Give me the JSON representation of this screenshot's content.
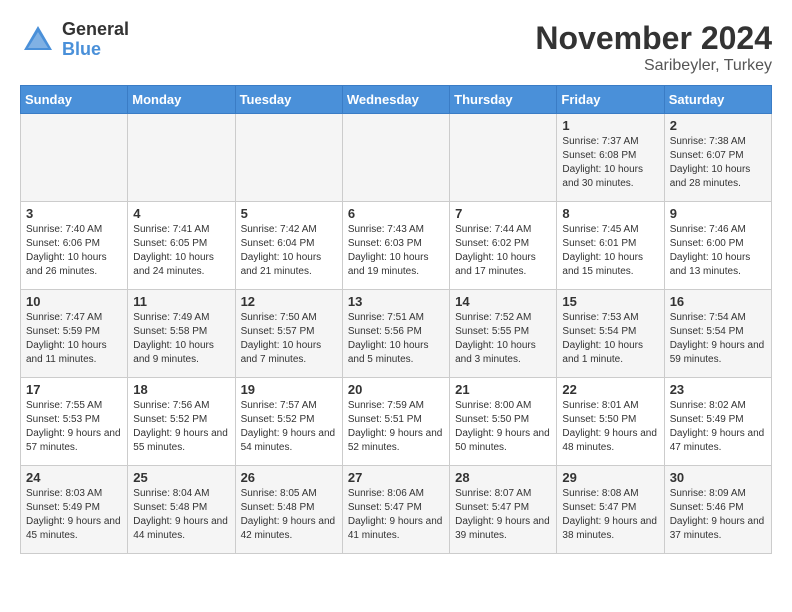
{
  "logo": {
    "general": "General",
    "blue": "Blue"
  },
  "title": "November 2024",
  "location": "Saribeyler, Turkey",
  "days_of_week": [
    "Sunday",
    "Monday",
    "Tuesday",
    "Wednesday",
    "Thursday",
    "Friday",
    "Saturday"
  ],
  "weeks": [
    [
      {
        "day": "",
        "info": ""
      },
      {
        "day": "",
        "info": ""
      },
      {
        "day": "",
        "info": ""
      },
      {
        "day": "",
        "info": ""
      },
      {
        "day": "",
        "info": ""
      },
      {
        "day": "1",
        "info": "Sunrise: 7:37 AM\nSunset: 6:08 PM\nDaylight: 10 hours and 30 minutes."
      },
      {
        "day": "2",
        "info": "Sunrise: 7:38 AM\nSunset: 6:07 PM\nDaylight: 10 hours and 28 minutes."
      }
    ],
    [
      {
        "day": "3",
        "info": "Sunrise: 7:40 AM\nSunset: 6:06 PM\nDaylight: 10 hours and 26 minutes."
      },
      {
        "day": "4",
        "info": "Sunrise: 7:41 AM\nSunset: 6:05 PM\nDaylight: 10 hours and 24 minutes."
      },
      {
        "day": "5",
        "info": "Sunrise: 7:42 AM\nSunset: 6:04 PM\nDaylight: 10 hours and 21 minutes."
      },
      {
        "day": "6",
        "info": "Sunrise: 7:43 AM\nSunset: 6:03 PM\nDaylight: 10 hours and 19 minutes."
      },
      {
        "day": "7",
        "info": "Sunrise: 7:44 AM\nSunset: 6:02 PM\nDaylight: 10 hours and 17 minutes."
      },
      {
        "day": "8",
        "info": "Sunrise: 7:45 AM\nSunset: 6:01 PM\nDaylight: 10 hours and 15 minutes."
      },
      {
        "day": "9",
        "info": "Sunrise: 7:46 AM\nSunset: 6:00 PM\nDaylight: 10 hours and 13 minutes."
      }
    ],
    [
      {
        "day": "10",
        "info": "Sunrise: 7:47 AM\nSunset: 5:59 PM\nDaylight: 10 hours and 11 minutes."
      },
      {
        "day": "11",
        "info": "Sunrise: 7:49 AM\nSunset: 5:58 PM\nDaylight: 10 hours and 9 minutes."
      },
      {
        "day": "12",
        "info": "Sunrise: 7:50 AM\nSunset: 5:57 PM\nDaylight: 10 hours and 7 minutes."
      },
      {
        "day": "13",
        "info": "Sunrise: 7:51 AM\nSunset: 5:56 PM\nDaylight: 10 hours and 5 minutes."
      },
      {
        "day": "14",
        "info": "Sunrise: 7:52 AM\nSunset: 5:55 PM\nDaylight: 10 hours and 3 minutes."
      },
      {
        "day": "15",
        "info": "Sunrise: 7:53 AM\nSunset: 5:54 PM\nDaylight: 10 hours and 1 minute."
      },
      {
        "day": "16",
        "info": "Sunrise: 7:54 AM\nSunset: 5:54 PM\nDaylight: 9 hours and 59 minutes."
      }
    ],
    [
      {
        "day": "17",
        "info": "Sunrise: 7:55 AM\nSunset: 5:53 PM\nDaylight: 9 hours and 57 minutes."
      },
      {
        "day": "18",
        "info": "Sunrise: 7:56 AM\nSunset: 5:52 PM\nDaylight: 9 hours and 55 minutes."
      },
      {
        "day": "19",
        "info": "Sunrise: 7:57 AM\nSunset: 5:52 PM\nDaylight: 9 hours and 54 minutes."
      },
      {
        "day": "20",
        "info": "Sunrise: 7:59 AM\nSunset: 5:51 PM\nDaylight: 9 hours and 52 minutes."
      },
      {
        "day": "21",
        "info": "Sunrise: 8:00 AM\nSunset: 5:50 PM\nDaylight: 9 hours and 50 minutes."
      },
      {
        "day": "22",
        "info": "Sunrise: 8:01 AM\nSunset: 5:50 PM\nDaylight: 9 hours and 48 minutes."
      },
      {
        "day": "23",
        "info": "Sunrise: 8:02 AM\nSunset: 5:49 PM\nDaylight: 9 hours and 47 minutes."
      }
    ],
    [
      {
        "day": "24",
        "info": "Sunrise: 8:03 AM\nSunset: 5:49 PM\nDaylight: 9 hours and 45 minutes."
      },
      {
        "day": "25",
        "info": "Sunrise: 8:04 AM\nSunset: 5:48 PM\nDaylight: 9 hours and 44 minutes."
      },
      {
        "day": "26",
        "info": "Sunrise: 8:05 AM\nSunset: 5:48 PM\nDaylight: 9 hours and 42 minutes."
      },
      {
        "day": "27",
        "info": "Sunrise: 8:06 AM\nSunset: 5:47 PM\nDaylight: 9 hours and 41 minutes."
      },
      {
        "day": "28",
        "info": "Sunrise: 8:07 AM\nSunset: 5:47 PM\nDaylight: 9 hours and 39 minutes."
      },
      {
        "day": "29",
        "info": "Sunrise: 8:08 AM\nSunset: 5:47 PM\nDaylight: 9 hours and 38 minutes."
      },
      {
        "day": "30",
        "info": "Sunrise: 8:09 AM\nSunset: 5:46 PM\nDaylight: 9 hours and 37 minutes."
      }
    ]
  ]
}
